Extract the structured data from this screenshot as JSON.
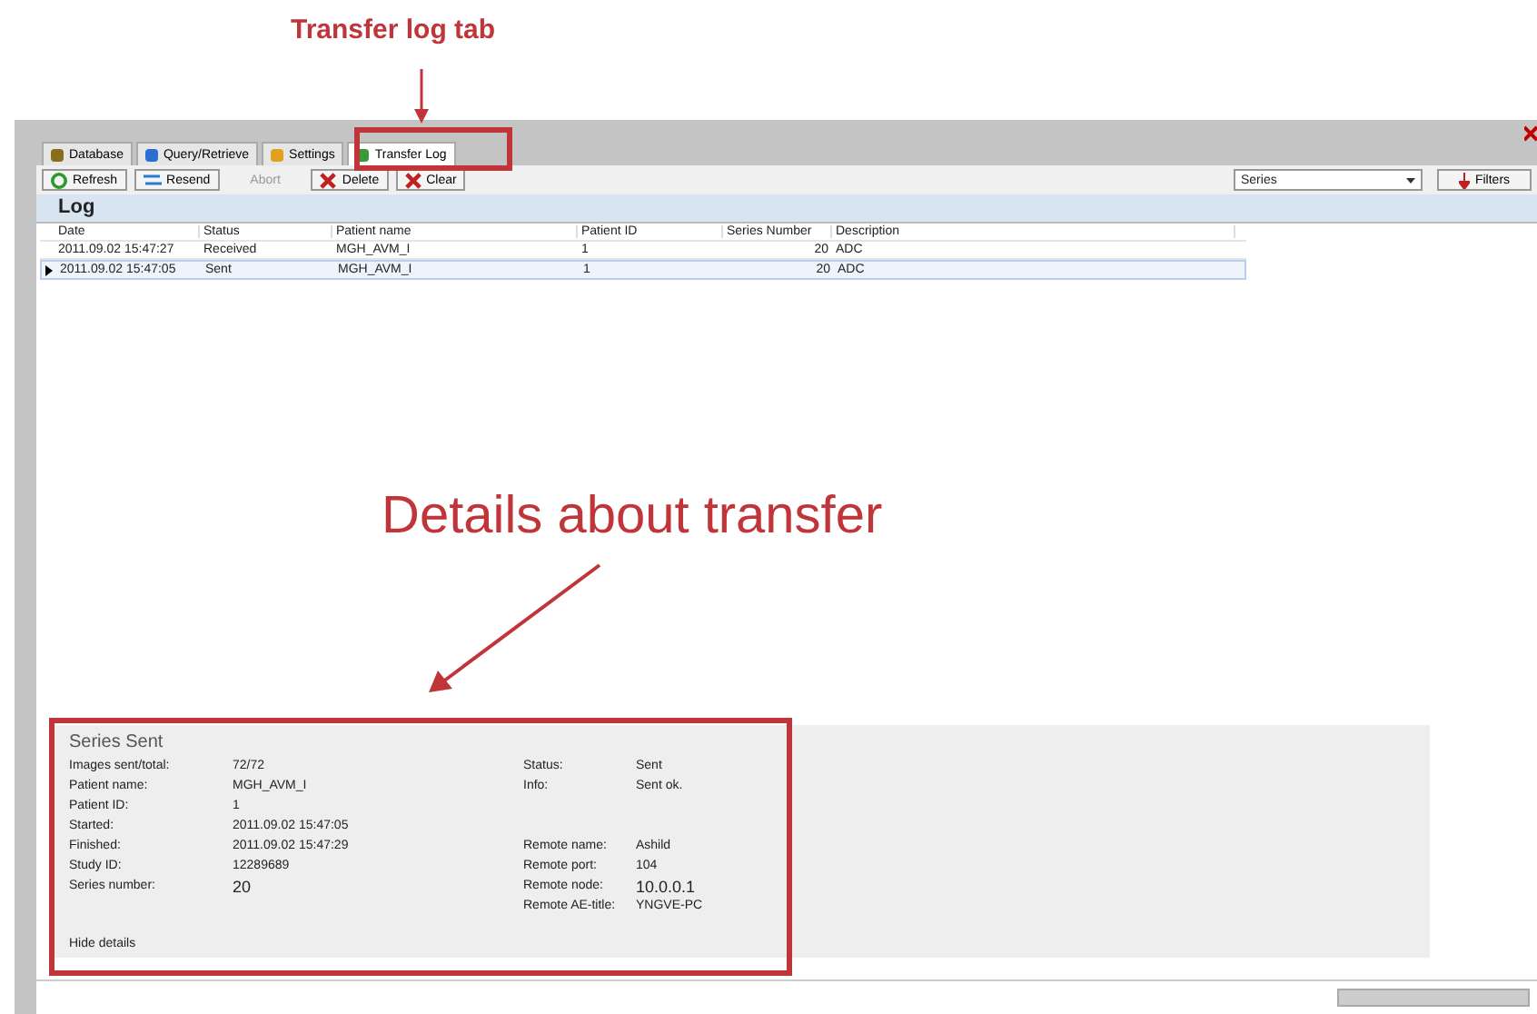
{
  "annotations": [
    {
      "kind": "tab",
      "text": "Transfer log tab"
    },
    {
      "kind": "details",
      "text": "Details about transfer"
    }
  ],
  "tabs": [
    {
      "label": "Database",
      "selected": false
    },
    {
      "label": "Query/Retrieve",
      "selected": false
    },
    {
      "label": "Settings",
      "selected": false
    },
    {
      "label": "Transfer Log",
      "selected": true
    }
  ],
  "toolbar": {
    "buttons": [
      {
        "label": "Refresh",
        "kind": "refresh",
        "disabled": false
      },
      {
        "label": "Resend",
        "kind": "resend",
        "disabled": false
      },
      {
        "label": "Abort",
        "kind": "plain",
        "disabled": true
      },
      {
        "label": "Delete",
        "kind": "delete",
        "disabled": false
      },
      {
        "label": "Clear",
        "kind": "delete",
        "disabled": false
      }
    ],
    "dropdown": {
      "value": "Series"
    },
    "filters_button": "Filters"
  },
  "section_title": "Log",
  "table": {
    "columns": [
      "Date",
      "Status",
      "Patient name",
      "Patient ID",
      "Series Number",
      "Description"
    ],
    "rows": [
      {
        "cells": [
          "2011.09.02 15:47:27",
          "Received",
          "MGH_AVM_I",
          "1",
          "20",
          "ADC"
        ],
        "selected": false
      },
      {
        "cells": [
          "2011.09.02 15:47:05",
          "Sent",
          "MGH_AVM_I",
          "1",
          "20",
          "ADC"
        ],
        "selected": true
      }
    ]
  },
  "details": {
    "title": "Series Sent",
    "left": [
      {
        "label": "Images sent/total:",
        "value": "72/72"
      },
      {
        "label": "Patient name:",
        "value": "MGH_AVM_I"
      },
      {
        "label": "Patient ID:",
        "value": "1"
      },
      {
        "label": "Started:",
        "value": "2011.09.02 15:47:05"
      },
      {
        "label": "Finished:",
        "value": "2011.09.02 15:47:29"
      },
      {
        "label": "Study ID:",
        "value": "12289689"
      },
      {
        "label": "Series number:",
        "value": "20"
      }
    ],
    "right": [
      {
        "label": "Status:",
        "value": "Sent"
      },
      {
        "label": "Info:",
        "value": "Sent ok."
      },
      {
        "label": "Remote name:",
        "value": "Ashild"
      },
      {
        "label": "Remote port:",
        "value": "104"
      },
      {
        "label": "Remote node:",
        "value": "10.0.0.1"
      },
      {
        "label": "Remote AE-title:",
        "value": "YNGVE-PC"
      }
    ],
    "hide_link": "Hide details"
  }
}
